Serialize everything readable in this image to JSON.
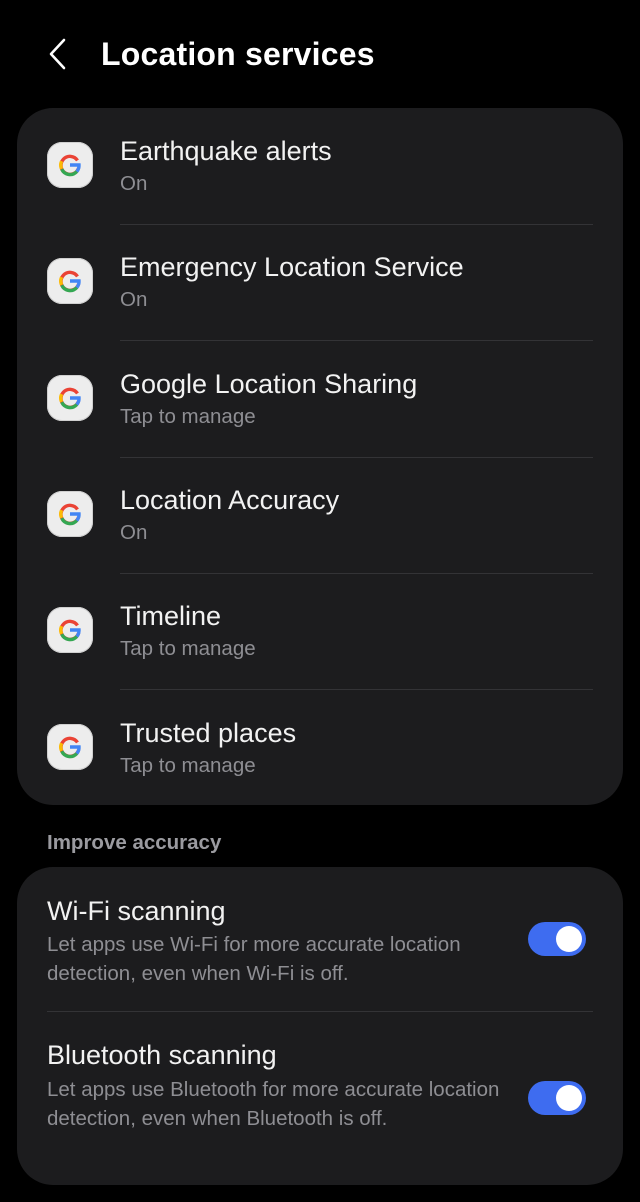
{
  "header": {
    "title": "Location services",
    "back_icon": "chevron-left-icon"
  },
  "apps": [
    {
      "title": "Earthquake alerts",
      "subtitle": "On",
      "icon": "google-icon"
    },
    {
      "title": "Emergency Location Service",
      "subtitle": "On",
      "icon": "google-icon"
    },
    {
      "title": "Google Location Sharing",
      "subtitle": "Tap to manage",
      "icon": "google-icon"
    },
    {
      "title": "Location Accuracy",
      "subtitle": "On",
      "icon": "google-icon"
    },
    {
      "title": "Timeline",
      "subtitle": "Tap to manage",
      "icon": "google-icon"
    },
    {
      "title": "Trusted places",
      "subtitle": "Tap to manage",
      "icon": "google-icon"
    }
  ],
  "improve_accuracy": {
    "header": "Improve accuracy",
    "wifi": {
      "title": "Wi-Fi scanning",
      "description": "Let apps use Wi-Fi for more accurate location detection, even when Wi-Fi is off.",
      "enabled": true
    },
    "bluetooth": {
      "title": "Bluetooth scanning",
      "description": "Let apps use Bluetooth for more accurate location detection, even when Bluetooth is off.",
      "enabled": true
    }
  },
  "colors": {
    "background": "#000000",
    "card": "#1c1c1e",
    "toggle_on": "#3e6cf0",
    "secondary_text": "#8e8e93",
    "google_blue": "#4285F4",
    "google_red": "#EA4335",
    "google_yellow": "#FBBC05",
    "google_green": "#34A853"
  }
}
